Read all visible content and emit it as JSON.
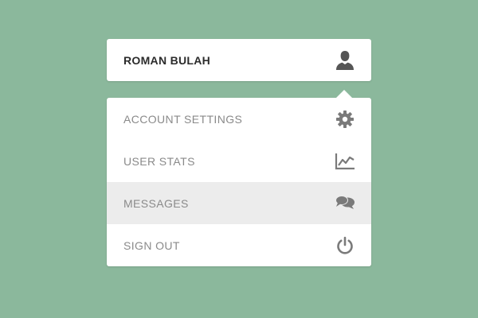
{
  "user": {
    "name": "ROMAN BULAH",
    "icon": "user-icon"
  },
  "menu": {
    "items": [
      {
        "label": "ACCOUNT SETTINGS",
        "icon": "gear-icon",
        "active": false
      },
      {
        "label": "USER STATS",
        "icon": "line-chart-icon",
        "active": false
      },
      {
        "label": "MESSAGES",
        "icon": "chat-bubbles-icon",
        "active": true
      },
      {
        "label": "SIGN OUT",
        "icon": "power-icon",
        "active": false
      }
    ]
  },
  "colors": {
    "background": "#8bb89c",
    "panel": "#ffffff",
    "active_row": "#ececec",
    "name_text": "#2b2b2b",
    "item_text": "#8a8a8a",
    "icon": "#7a7a7a",
    "user_icon": "#555555"
  }
}
